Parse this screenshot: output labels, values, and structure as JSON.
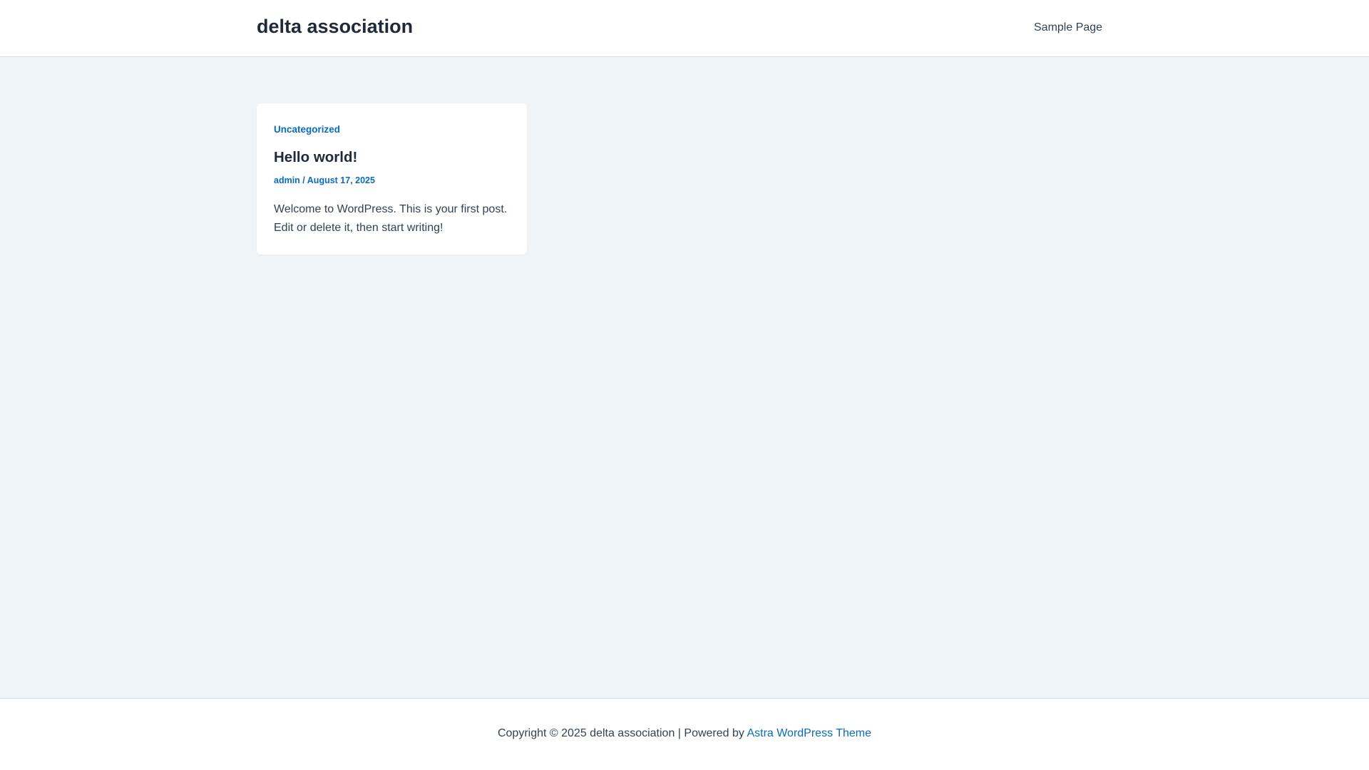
{
  "header": {
    "site_title": "delta association",
    "nav": [
      {
        "label": "Sample Page"
      }
    ]
  },
  "post": {
    "category": "Uncategorized",
    "title": "Hello world!",
    "author": "admin",
    "separator": " / ",
    "date": "August 17, 2025",
    "excerpt": "Welcome to WordPress. This is your first post. Edit or delete it, then start writing!"
  },
  "footer": {
    "copyright_text": "Copyright © 2025 delta association | Powered by ",
    "theme_link": "Astra WordPress Theme"
  },
  "colors": {
    "accent": "#046bd2",
    "heading": "#1e293b",
    "text": "#334155",
    "background": "#eff4f8",
    "surface": "#ffffff"
  }
}
